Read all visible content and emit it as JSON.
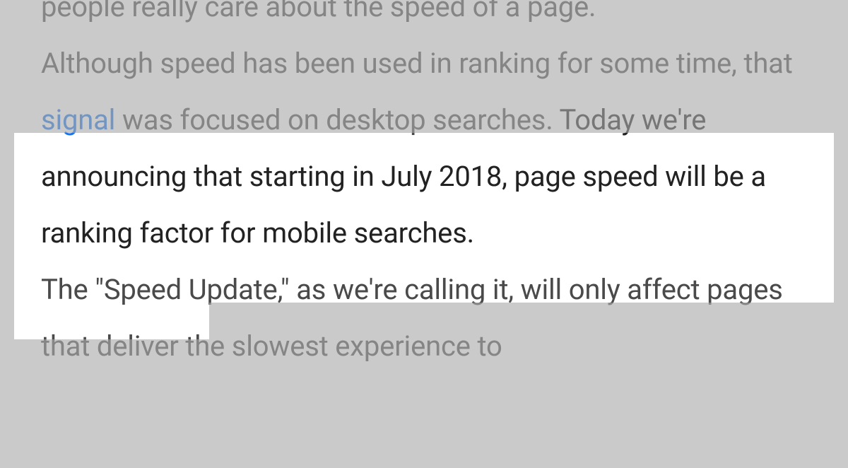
{
  "article": {
    "truncated_top": "people really care about the speed of a page.",
    "para1_before_link": "Although speed has been used in ranking for some time, that ",
    "link_text": "signal",
    "para1_after_link": " was focused on desktop searches. ",
    "highlighted_sentence": "Today we're announcing that starting in July 2018, page speed will be a ranking factor for mobile searches.",
    "para2": "The \"Speed Update,\" as we're calling it, will only affect pages that deliver the slowest experience to"
  }
}
